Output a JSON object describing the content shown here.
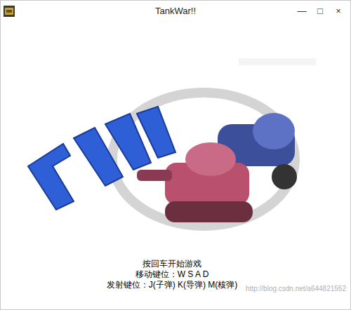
{
  "window": {
    "title": "TankWar!!",
    "controls": [
      "—",
      "□",
      "×"
    ]
  },
  "instructions": [
    "按回车开始游戏",
    "移动键位：W S A D",
    "发射键位：J(子弹) K(导弹) M(核弹)"
  ],
  "watermark": "http://blog.csdn.net/a644821552"
}
